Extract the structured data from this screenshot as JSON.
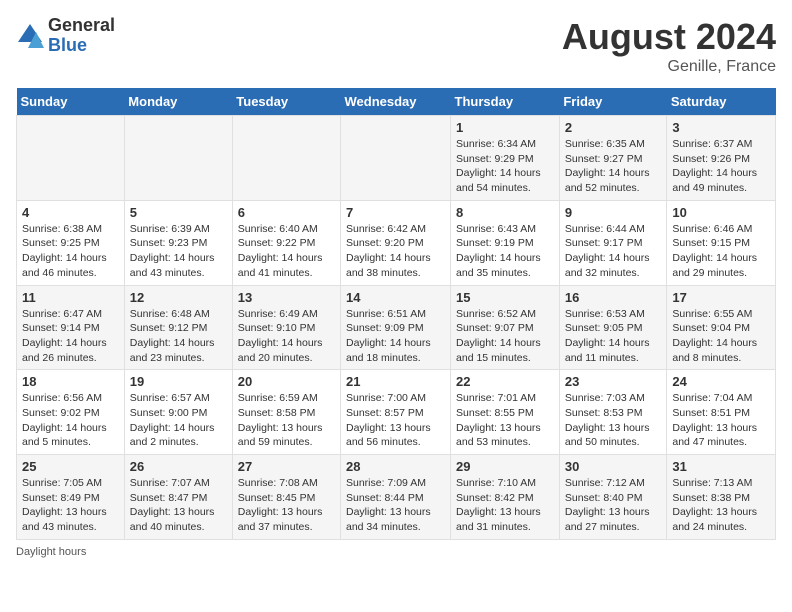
{
  "header": {
    "logo_general": "General",
    "logo_blue": "Blue",
    "month_year": "August 2024",
    "location": "Genille, France"
  },
  "days_of_week": [
    "Sunday",
    "Monday",
    "Tuesday",
    "Wednesday",
    "Thursday",
    "Friday",
    "Saturday"
  ],
  "weeks": [
    [
      {
        "day": "",
        "info": ""
      },
      {
        "day": "",
        "info": ""
      },
      {
        "day": "",
        "info": ""
      },
      {
        "day": "",
        "info": ""
      },
      {
        "day": "1",
        "info": "Sunrise: 6:34 AM\nSunset: 9:29 PM\nDaylight: 14 hours and 54 minutes."
      },
      {
        "day": "2",
        "info": "Sunrise: 6:35 AM\nSunset: 9:27 PM\nDaylight: 14 hours and 52 minutes."
      },
      {
        "day": "3",
        "info": "Sunrise: 6:37 AM\nSunset: 9:26 PM\nDaylight: 14 hours and 49 minutes."
      }
    ],
    [
      {
        "day": "4",
        "info": "Sunrise: 6:38 AM\nSunset: 9:25 PM\nDaylight: 14 hours and 46 minutes."
      },
      {
        "day": "5",
        "info": "Sunrise: 6:39 AM\nSunset: 9:23 PM\nDaylight: 14 hours and 43 minutes."
      },
      {
        "day": "6",
        "info": "Sunrise: 6:40 AM\nSunset: 9:22 PM\nDaylight: 14 hours and 41 minutes."
      },
      {
        "day": "7",
        "info": "Sunrise: 6:42 AM\nSunset: 9:20 PM\nDaylight: 14 hours and 38 minutes."
      },
      {
        "day": "8",
        "info": "Sunrise: 6:43 AM\nSunset: 9:19 PM\nDaylight: 14 hours and 35 minutes."
      },
      {
        "day": "9",
        "info": "Sunrise: 6:44 AM\nSunset: 9:17 PM\nDaylight: 14 hours and 32 minutes."
      },
      {
        "day": "10",
        "info": "Sunrise: 6:46 AM\nSunset: 9:15 PM\nDaylight: 14 hours and 29 minutes."
      }
    ],
    [
      {
        "day": "11",
        "info": "Sunrise: 6:47 AM\nSunset: 9:14 PM\nDaylight: 14 hours and 26 minutes."
      },
      {
        "day": "12",
        "info": "Sunrise: 6:48 AM\nSunset: 9:12 PM\nDaylight: 14 hours and 23 minutes."
      },
      {
        "day": "13",
        "info": "Sunrise: 6:49 AM\nSunset: 9:10 PM\nDaylight: 14 hours and 20 minutes."
      },
      {
        "day": "14",
        "info": "Sunrise: 6:51 AM\nSunset: 9:09 PM\nDaylight: 14 hours and 18 minutes."
      },
      {
        "day": "15",
        "info": "Sunrise: 6:52 AM\nSunset: 9:07 PM\nDaylight: 14 hours and 15 minutes."
      },
      {
        "day": "16",
        "info": "Sunrise: 6:53 AM\nSunset: 9:05 PM\nDaylight: 14 hours and 11 minutes."
      },
      {
        "day": "17",
        "info": "Sunrise: 6:55 AM\nSunset: 9:04 PM\nDaylight: 14 hours and 8 minutes."
      }
    ],
    [
      {
        "day": "18",
        "info": "Sunrise: 6:56 AM\nSunset: 9:02 PM\nDaylight: 14 hours and 5 minutes."
      },
      {
        "day": "19",
        "info": "Sunrise: 6:57 AM\nSunset: 9:00 PM\nDaylight: 14 hours and 2 minutes."
      },
      {
        "day": "20",
        "info": "Sunrise: 6:59 AM\nSunset: 8:58 PM\nDaylight: 13 hours and 59 minutes."
      },
      {
        "day": "21",
        "info": "Sunrise: 7:00 AM\nSunset: 8:57 PM\nDaylight: 13 hours and 56 minutes."
      },
      {
        "day": "22",
        "info": "Sunrise: 7:01 AM\nSunset: 8:55 PM\nDaylight: 13 hours and 53 minutes."
      },
      {
        "day": "23",
        "info": "Sunrise: 7:03 AM\nSunset: 8:53 PM\nDaylight: 13 hours and 50 minutes."
      },
      {
        "day": "24",
        "info": "Sunrise: 7:04 AM\nSunset: 8:51 PM\nDaylight: 13 hours and 47 minutes."
      }
    ],
    [
      {
        "day": "25",
        "info": "Sunrise: 7:05 AM\nSunset: 8:49 PM\nDaylight: 13 hours and 43 minutes."
      },
      {
        "day": "26",
        "info": "Sunrise: 7:07 AM\nSunset: 8:47 PM\nDaylight: 13 hours and 40 minutes."
      },
      {
        "day": "27",
        "info": "Sunrise: 7:08 AM\nSunset: 8:45 PM\nDaylight: 13 hours and 37 minutes."
      },
      {
        "day": "28",
        "info": "Sunrise: 7:09 AM\nSunset: 8:44 PM\nDaylight: 13 hours and 34 minutes."
      },
      {
        "day": "29",
        "info": "Sunrise: 7:10 AM\nSunset: 8:42 PM\nDaylight: 13 hours and 31 minutes."
      },
      {
        "day": "30",
        "info": "Sunrise: 7:12 AM\nSunset: 8:40 PM\nDaylight: 13 hours and 27 minutes."
      },
      {
        "day": "31",
        "info": "Sunrise: 7:13 AM\nSunset: 8:38 PM\nDaylight: 13 hours and 24 minutes."
      }
    ]
  ],
  "footer": {
    "note": "Daylight hours"
  }
}
